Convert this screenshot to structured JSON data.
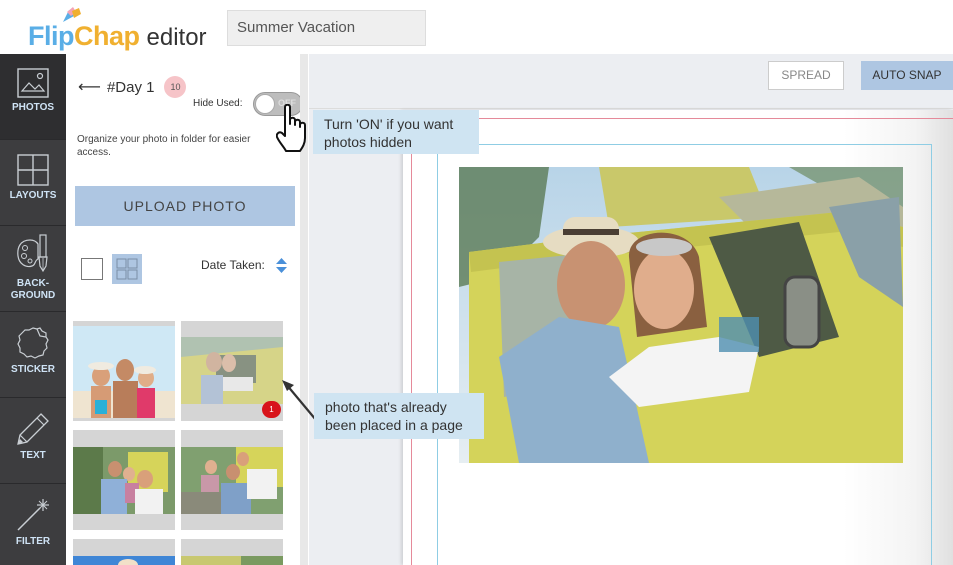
{
  "app": {
    "logo_flip": "Flip",
    "logo_chap": "Chap",
    "logo_suffix": "editor",
    "project_title": "Summer Vacation"
  },
  "colors": {
    "accent": "#aec6e2",
    "rail_bg": "#3d3d3f",
    "used_badge": "#d8141b",
    "callout_bg": "#cfe4f2",
    "bleed_line": "#e58a9a",
    "safe_line": "#8fcde4"
  },
  "rail": {
    "items": [
      {
        "id": "photos",
        "label": "PHOTOS",
        "icon": "image-icon",
        "active": true
      },
      {
        "id": "layouts",
        "label": "LAYOUTS",
        "icon": "layout-grid-icon"
      },
      {
        "id": "background",
        "label": "BACK-\nGROUND",
        "label_line1": "BACK-",
        "label_line2": "GROUND",
        "icon": "palette-icon"
      },
      {
        "id": "sticker",
        "label": "STICKER",
        "icon": "sticker-icon"
      },
      {
        "id": "text",
        "label": "TEXT",
        "icon": "pencil-icon"
      },
      {
        "id": "filter",
        "label": "FILTER",
        "icon": "magic-wand-icon"
      }
    ]
  },
  "panel": {
    "back_arrow": "⟵",
    "folder_name": "#Day 1",
    "folder_count": "10",
    "hide_used_label": "Hide Used:",
    "toggle_state": "OFF",
    "description": "Organize your photo in folder for easier access.",
    "upload_label": "UPLOAD PHOTO",
    "sort_label": "Date Taken:",
    "thumbnails": [
      {
        "name": "family-beach",
        "used_count": null
      },
      {
        "name": "couple-van",
        "used_count": "1"
      },
      {
        "name": "family-van-1",
        "used_count": null
      },
      {
        "name": "family-van-2",
        "used_count": null
      },
      {
        "name": "sky-photo",
        "used_count": null
      },
      {
        "name": "trees-photo",
        "used_count": null
      }
    ]
  },
  "toolbar": {
    "spread_label": "SPREAD",
    "autosnap_label": "AUTO SNAP"
  },
  "callouts": {
    "hide_used_tip": "Turn 'ON' if you want photos hidden",
    "used_photo_tip": "photo that's already been placed in a page"
  }
}
